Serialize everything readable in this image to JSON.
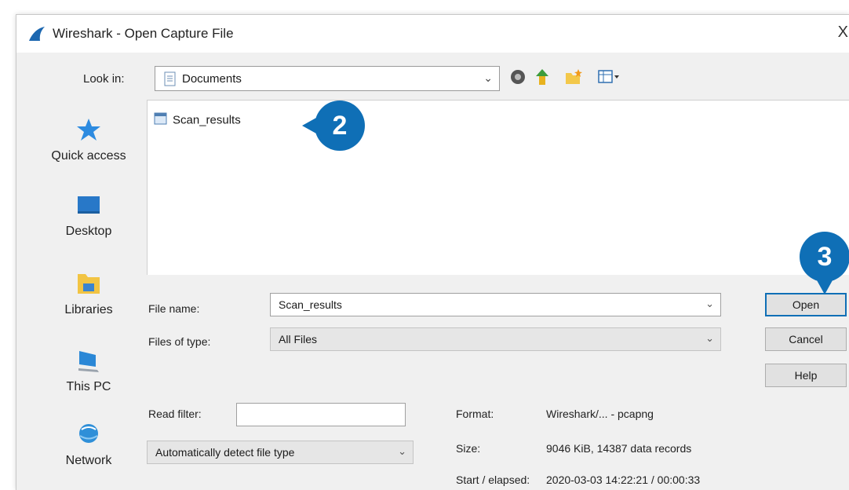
{
  "window": {
    "title": "Wireshark - Open Capture File",
    "close_glyph": "X"
  },
  "toolbar": {
    "look_in_label": "Look in:",
    "look_in_value": "Documents",
    "icons": [
      "back-icon",
      "up-folder-icon",
      "new-folder-icon",
      "view-menu-icon"
    ]
  },
  "places": [
    {
      "label": "Quick access",
      "icon": "star-icon"
    },
    {
      "label": "Desktop",
      "icon": "desktop-icon"
    },
    {
      "label": "Libraries",
      "icon": "libraries-icon"
    },
    {
      "label": "This PC",
      "icon": "computer-icon"
    },
    {
      "label": "Network",
      "icon": "network-icon"
    }
  ],
  "files": [
    {
      "name": "Scan_results"
    }
  ],
  "callouts": {
    "step2": "2",
    "step3": "3"
  },
  "form": {
    "file_name_label": "File name:",
    "file_name_value": "Scan_results",
    "files_of_type_label": "Files of type:",
    "files_of_type_value": "All Files",
    "read_filter_label": "Read filter:",
    "read_filter_value": "",
    "detect_value": "Automatically detect file type"
  },
  "buttons": {
    "open": "Open",
    "cancel": "Cancel",
    "help": "Help"
  },
  "info": {
    "format_label": "Format:",
    "format_value": "Wireshark/... - pcapng",
    "size_label": "Size:",
    "size_value": "9046 KiB, 14387 data records",
    "start_label": "Start / elapsed:",
    "start_value": "2020-03-03 14:22:21 / 00:00:33"
  },
  "colors": {
    "accent": "#0f6fb6",
    "dialog_bg": "#f0f0f0"
  }
}
